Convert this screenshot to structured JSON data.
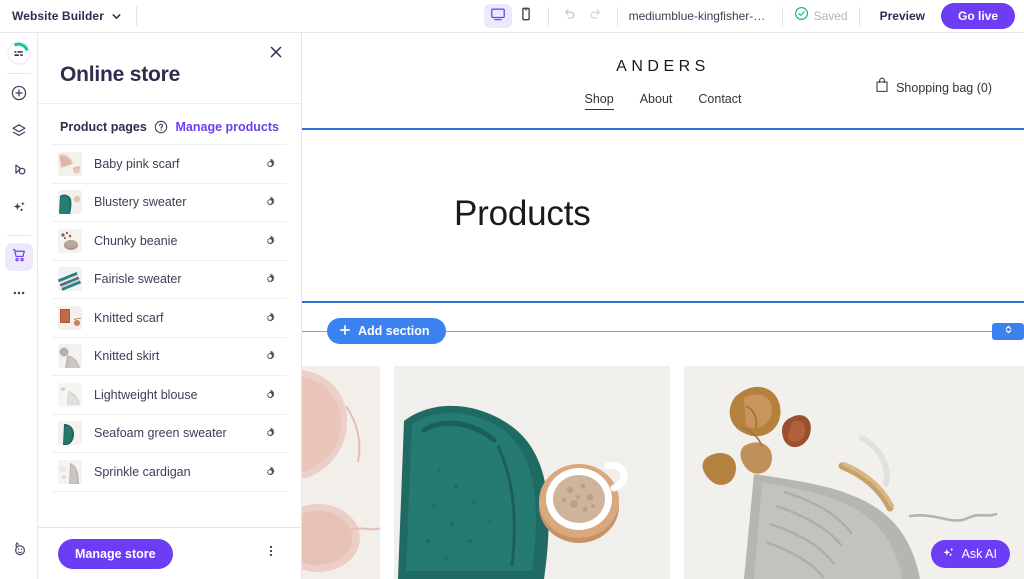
{
  "topbar": {
    "app_title": "Website Builder",
    "caret_icon": "chevron-down-icon",
    "desktop_icon": "desktop-monitor-icon",
    "mobile_icon": "mobile-phone-icon",
    "undo_icon": "undo-arrow-icon",
    "redo_icon": "redo-arrow-icon",
    "site_name": "mediumblue-kingfisher-ynqj...",
    "saved_icon": "check-circle-icon",
    "saved_label": "Saved",
    "preview_label": "Preview",
    "golive_label": "Go live",
    "accent_purple": "#6c3df4",
    "saved_green": "#13b98a"
  },
  "rail": {
    "logo_icon": "builder-logo-icon",
    "items": [
      {
        "icon": "plus-circle-icon",
        "name": "add-element",
        "active": false
      },
      {
        "icon": "layers-icon",
        "name": "pages-layers",
        "active": false
      },
      {
        "icon": "theme-paint-icon",
        "name": "site-theme",
        "active": false
      },
      {
        "icon": "sparkles-icon",
        "name": "ai-tools",
        "active": false
      },
      {
        "icon": "shopping-cart-icon",
        "name": "online-store",
        "active": true
      },
      {
        "icon": "ellipsis-icon",
        "name": "more-options",
        "active": false
      }
    ],
    "bottom_icon": "help-support-icon"
  },
  "panel": {
    "title": "Online store",
    "close_icon": "close-x-icon",
    "section_title": "Product pages",
    "help_icon": "question-mark-circle-icon",
    "manage_products_label": "Manage products",
    "gear_icon": "gear-settings-icon",
    "products": [
      {
        "name": "Baby pink scarf",
        "thumb": "baby-pink-scarf"
      },
      {
        "name": "Blustery sweater",
        "thumb": "blustery-sweater"
      },
      {
        "name": "Chunky beanie",
        "thumb": "chunky-beanie"
      },
      {
        "name": "Fairisle sweater",
        "thumb": "fairisle-sweater"
      },
      {
        "name": "Knitted scarf",
        "thumb": "knitted-scarf"
      },
      {
        "name": "Knitted skirt",
        "thumb": "knitted-skirt"
      },
      {
        "name": "Lightweight blouse",
        "thumb": "lightweight-blouse"
      },
      {
        "name": "Seafoam green sweater",
        "thumb": "seafoam-green-sweater"
      },
      {
        "name": "Sprinkle cardigan",
        "thumb": "sprinkle-cardigan"
      }
    ],
    "manage_store_label": "Manage store",
    "kebab_icon": "vertical-ellipsis-icon"
  },
  "canvas": {
    "brand": "ANDERS",
    "nav": [
      {
        "label": "Shop",
        "active": true
      },
      {
        "label": "About",
        "active": false
      },
      {
        "label": "Contact",
        "active": false
      }
    ],
    "bag_icon": "shopping-bag-icon",
    "bag_label": "Shopping bag (0)",
    "page_heading": "Products",
    "add_section_label": "Add section",
    "add_section_icon": "plus-icon",
    "resize_icon": "resize-vertical-icon",
    "selection_color": "#2f6fd8",
    "gallery": [
      {
        "alt": "pink-knit-and-yarn"
      },
      {
        "alt": "teal-sweater-with-coffee"
      },
      {
        "alt": "grey-knitting-with-leaves"
      }
    ]
  },
  "askai": {
    "label": "Ask AI",
    "icon": "sparkles-icon"
  }
}
